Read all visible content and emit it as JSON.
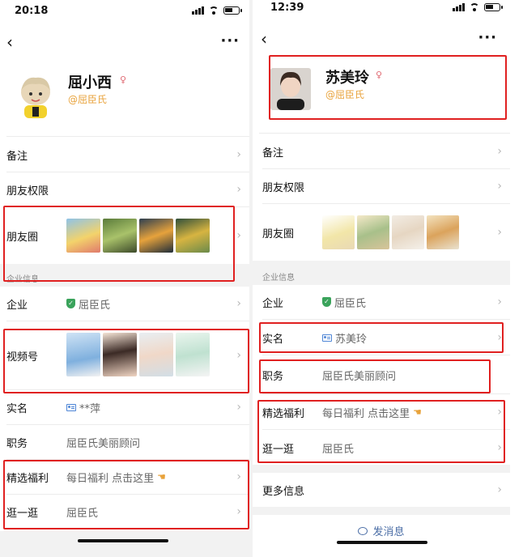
{
  "left": {
    "time": "20:18",
    "name": "屈小西",
    "corp_tag": "@屈臣氏",
    "rows": {
      "remark": "备注",
      "permissions": "朋友权限",
      "moments": "朋友圈",
      "enterprise_section": "企业信息",
      "enterprise": "企业",
      "enterprise_value": "屈臣氏",
      "channels": "视频号",
      "realname": "实名",
      "realname_value": "**萍",
      "position": "职务",
      "position_value": "屈臣氏美丽顾问",
      "benefits": "精选福利",
      "benefits_value": "每日福利 点击这里",
      "stroll": "逛一逛",
      "stroll_value": "屈臣氏"
    }
  },
  "right": {
    "time": "12:39",
    "name": "苏美玲",
    "corp_tag": "@屈臣氏",
    "rows": {
      "remark": "备注",
      "permissions": "朋友权限",
      "moments": "朋友圈",
      "enterprise_section": "企业信息",
      "enterprise": "企业",
      "enterprise_value": "屈臣氏",
      "realname": "实名",
      "realname_value": "苏美玲",
      "position": "职务",
      "position_value": "屈臣氏美丽顾问",
      "benefits": "精选福利",
      "benefits_value": "每日福利 点击这里",
      "stroll": "逛一逛",
      "stroll_value": "屈臣氏",
      "more_info": "更多信息"
    },
    "send_message": "发消息"
  },
  "icons": {
    "back": "chevron-left-icon",
    "more": "more-dots-icon",
    "chevron": "chevron-right-icon",
    "gender": "female-icon",
    "verified": "shield-check-icon",
    "id_card": "id-card-icon",
    "hand": "pointing-hand-icon",
    "chat": "chat-bubble-icon"
  },
  "colors": {
    "highlight_box": "#e02020",
    "corp_tag": "#e8a23a",
    "verified": "#3aa35b",
    "link": "#4b6ea6"
  }
}
